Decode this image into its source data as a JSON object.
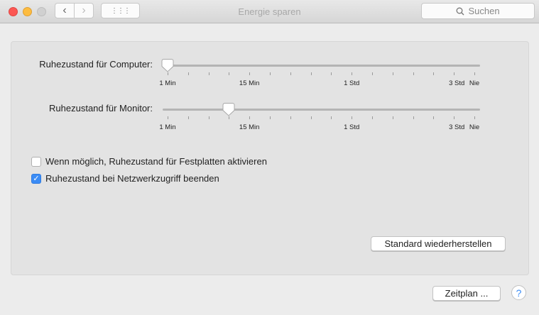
{
  "window": {
    "title": "Energie sparen",
    "search_placeholder": "Suchen"
  },
  "toolbar": {
    "back": "‹",
    "forward": "›",
    "grid": "⋮⋮⋮"
  },
  "sliders": [
    {
      "label": "Ruhezustand für Computer:",
      "value_index": 0,
      "tick_count": 16
    },
    {
      "label": "Ruhezustand für Monitor:",
      "value_index": 3,
      "tick_count": 16
    }
  ],
  "tick_labels": [
    {
      "text": "1 Min",
      "index": 0
    },
    {
      "text": "15 Min",
      "index": 4
    },
    {
      "text": "1 Std",
      "index": 9
    },
    {
      "text": "3 Std",
      "index": 14
    },
    {
      "text": "Nie",
      "index": 15
    }
  ],
  "checkboxes": [
    {
      "label": "Wenn möglich, Ruhezustand für Festplatten aktivieren",
      "checked": false
    },
    {
      "label": "Ruhezustand bei Netzwerkzugriff beenden",
      "checked": true
    }
  ],
  "buttons": {
    "restore_defaults": "Standard wiederherstellen",
    "schedule": "Zeitplan ...",
    "help": "?"
  }
}
